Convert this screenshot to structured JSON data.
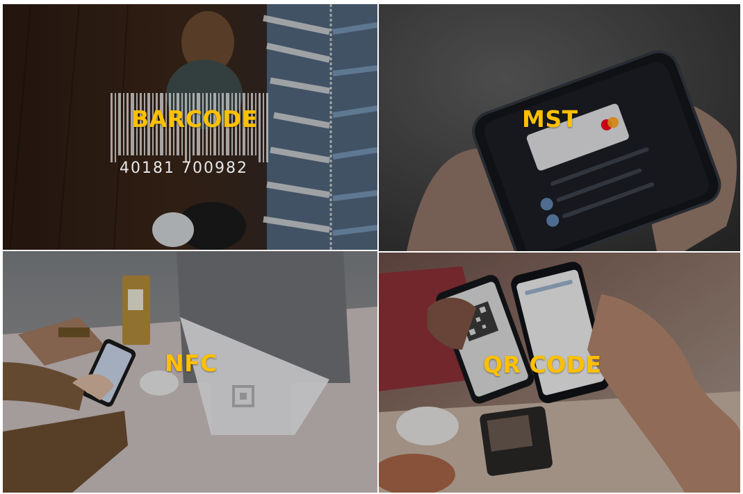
{
  "tiles": {
    "barcode": {
      "label": "BARCODE",
      "barcode_number": "40181 700982",
      "scene": "clothing-rack-photo"
    },
    "mst": {
      "label": "MST",
      "scene": "smartphone-payment-photo"
    },
    "nfc": {
      "label": "NFC",
      "scene": "contactless-terminal-photo"
    },
    "qr": {
      "label": "QR CODE",
      "scene": "qr-phone-scan-photo"
    }
  },
  "colors": {
    "label": "#ffc000",
    "background": "#ffffff"
  }
}
